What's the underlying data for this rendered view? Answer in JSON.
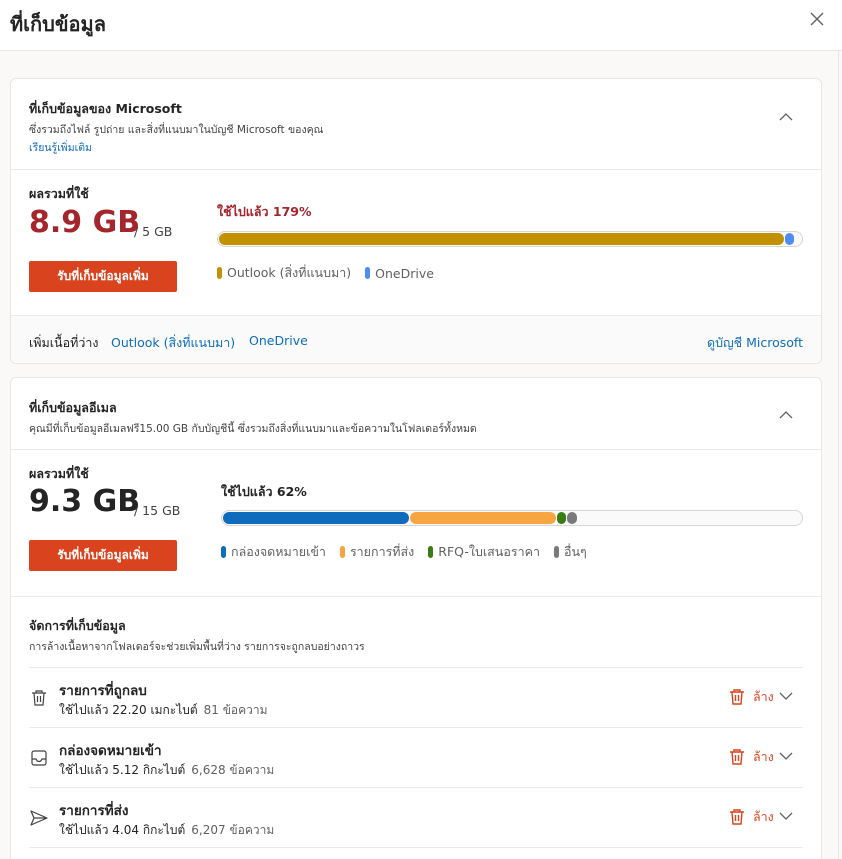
{
  "dialog": {
    "title": "ที่เก็บข้อมูล",
    "close_icon": "close-icon"
  },
  "microsoft_storage": {
    "title": "ที่เก็บข้อมูลของ Microsoft",
    "description": "ซึ่งรวมถึงไฟล์ รูปถ่าย และสิ่งที่แนบมาในบัญชี Microsoft ของคุณ",
    "learn_more": "เรียนรู้เพิ่มเติม",
    "total_label": "ผลรวมที่ใช้",
    "used": "8.9 GB",
    "of_total": "/ 5 GB",
    "usage_prefix": "ใช้ไปแล้ว ",
    "usage_percent": "179%",
    "button": "รับที่เก็บข้อมูลเพิ่ม",
    "bar": [
      {
        "name": "Outlook (สิ่งที่แนบมา)",
        "fraction": 0.97,
        "color": "#c19100"
      },
      {
        "name": "OneDrive",
        "fraction": 0.016,
        "color": "#4f8cf2"
      }
    ],
    "legend": [
      "Outlook (สิ่งที่แนบมา)",
      "OneDrive"
    ],
    "add_space_label": "เพิ่มเนื้อที่ว่าง",
    "add_space_links": [
      "Outlook (สิ่งที่แนบมา)",
      "OneDrive"
    ],
    "view_account": "ดูบัญชี Microsoft"
  },
  "mail_storage": {
    "title": "ที่เก็บข้อมูลอีเมล",
    "description": "คุณมีที่เก็บข้อมูลอีเมลฟรี15.00 GB กับบัญชีนี้ ซึ่งรวมถึงสิ่งที่แนบมาและข้อความในโฟลเดอร์ทั้งหมด",
    "total_label": "ผลรวมที่ใช้",
    "used": "9.3 GB",
    "of_total": "/ 15 GB",
    "usage_prefix": "ใช้ไปแล้ว ",
    "usage_percent": "62%",
    "button": "รับที่เก็บข้อมูลเพิ่ม",
    "bar": [
      {
        "name": "กล่องจดหมายเข้า",
        "fraction": 0.322,
        "color": "#0f6cbd"
      },
      {
        "name": "รายการที่ส่ง",
        "fraction": 0.252,
        "color": "#f7a541"
      },
      {
        "name": "RFQ-ใบเสนอราคา",
        "fraction": 0.016,
        "color": "#3a7d12"
      },
      {
        "name": "อื่นๆ",
        "fraction": 0.018,
        "color": "#7a7a7a"
      }
    ],
    "legend": [
      "กล่องจดหมายเข้า",
      "รายการที่ส่ง",
      "RFQ-ใบเสนอราคา",
      "อื่นๆ"
    ]
  },
  "manage": {
    "title": "จัดการที่เก็บข้อมูล",
    "description": "การล้างเนื้อหาจากโฟลเดอร์จะช่วยเพิ่มพื้นที่ว่าง รายการจะถูกลบอย่างถาวร",
    "clear_label": "ล้าง",
    "folders": [
      {
        "name": "รายการที่ถูกลบ",
        "usage": "ใช้ไปแล้ว 22.20 เมกะไบต์",
        "count": "81 ข้อความ",
        "icon": "trash-icon"
      },
      {
        "name": "กล่องจดหมายเข้า",
        "usage": "ใช้ไปแล้ว 5.12 กิกะไบต์",
        "count": "6,628 ข้อความ",
        "icon": "inbox-icon"
      },
      {
        "name": "รายการที่ส่ง",
        "usage": "ใช้ไปแล้ว 4.04 กิกะไบต์",
        "count": "6,207 ข้อความ",
        "icon": "send-icon"
      }
    ]
  },
  "colors": {
    "accent": "#0f6cbd",
    "danger": "#d9441f",
    "over_quota": "#a4262c"
  }
}
